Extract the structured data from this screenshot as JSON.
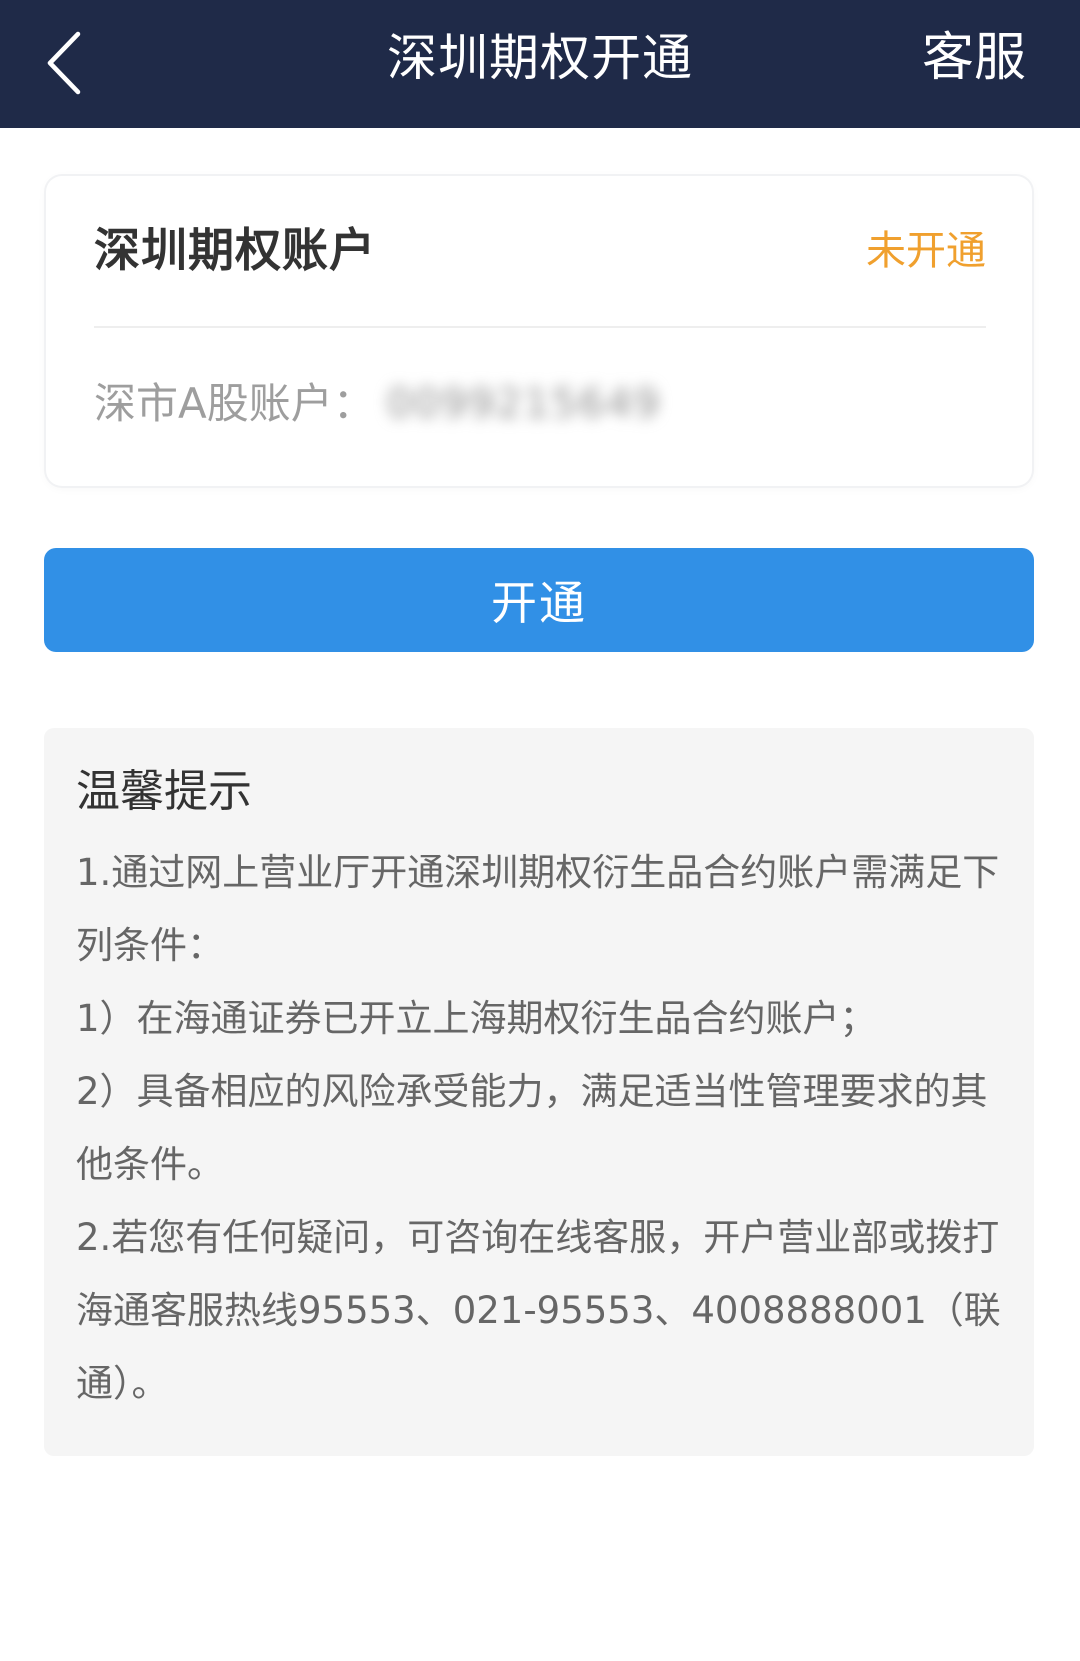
{
  "header": {
    "title": "深圳期权开通",
    "service_label": "客服",
    "back_icon": "chevron-left-icon"
  },
  "account_card": {
    "title": "深圳期权账户",
    "status": "未开通",
    "account_label": "深市A股账户：",
    "account_value": "0099215649"
  },
  "action": {
    "open_label": "开通"
  },
  "tips": {
    "title": "温馨提示",
    "items": [
      "1.通过网上营业厅开通深圳期权衍生品合约账户需满足下列条件：",
      "1）在海通证券已开立上海期权衍生品合约账户；",
      "2）具备相应的风险承受能力，满足适当性管理要求的其他条件。",
      "2.若您有任何疑问，可咨询在线客服，开户营业部或拨打海通客服热线95553、021-95553、4008888001（联通）。"
    ]
  },
  "colors": {
    "header_bg": "#1f2a48",
    "status_orange": "#f0a02e",
    "button_blue": "#3190e6",
    "tips_bg": "#f5f5f5"
  }
}
